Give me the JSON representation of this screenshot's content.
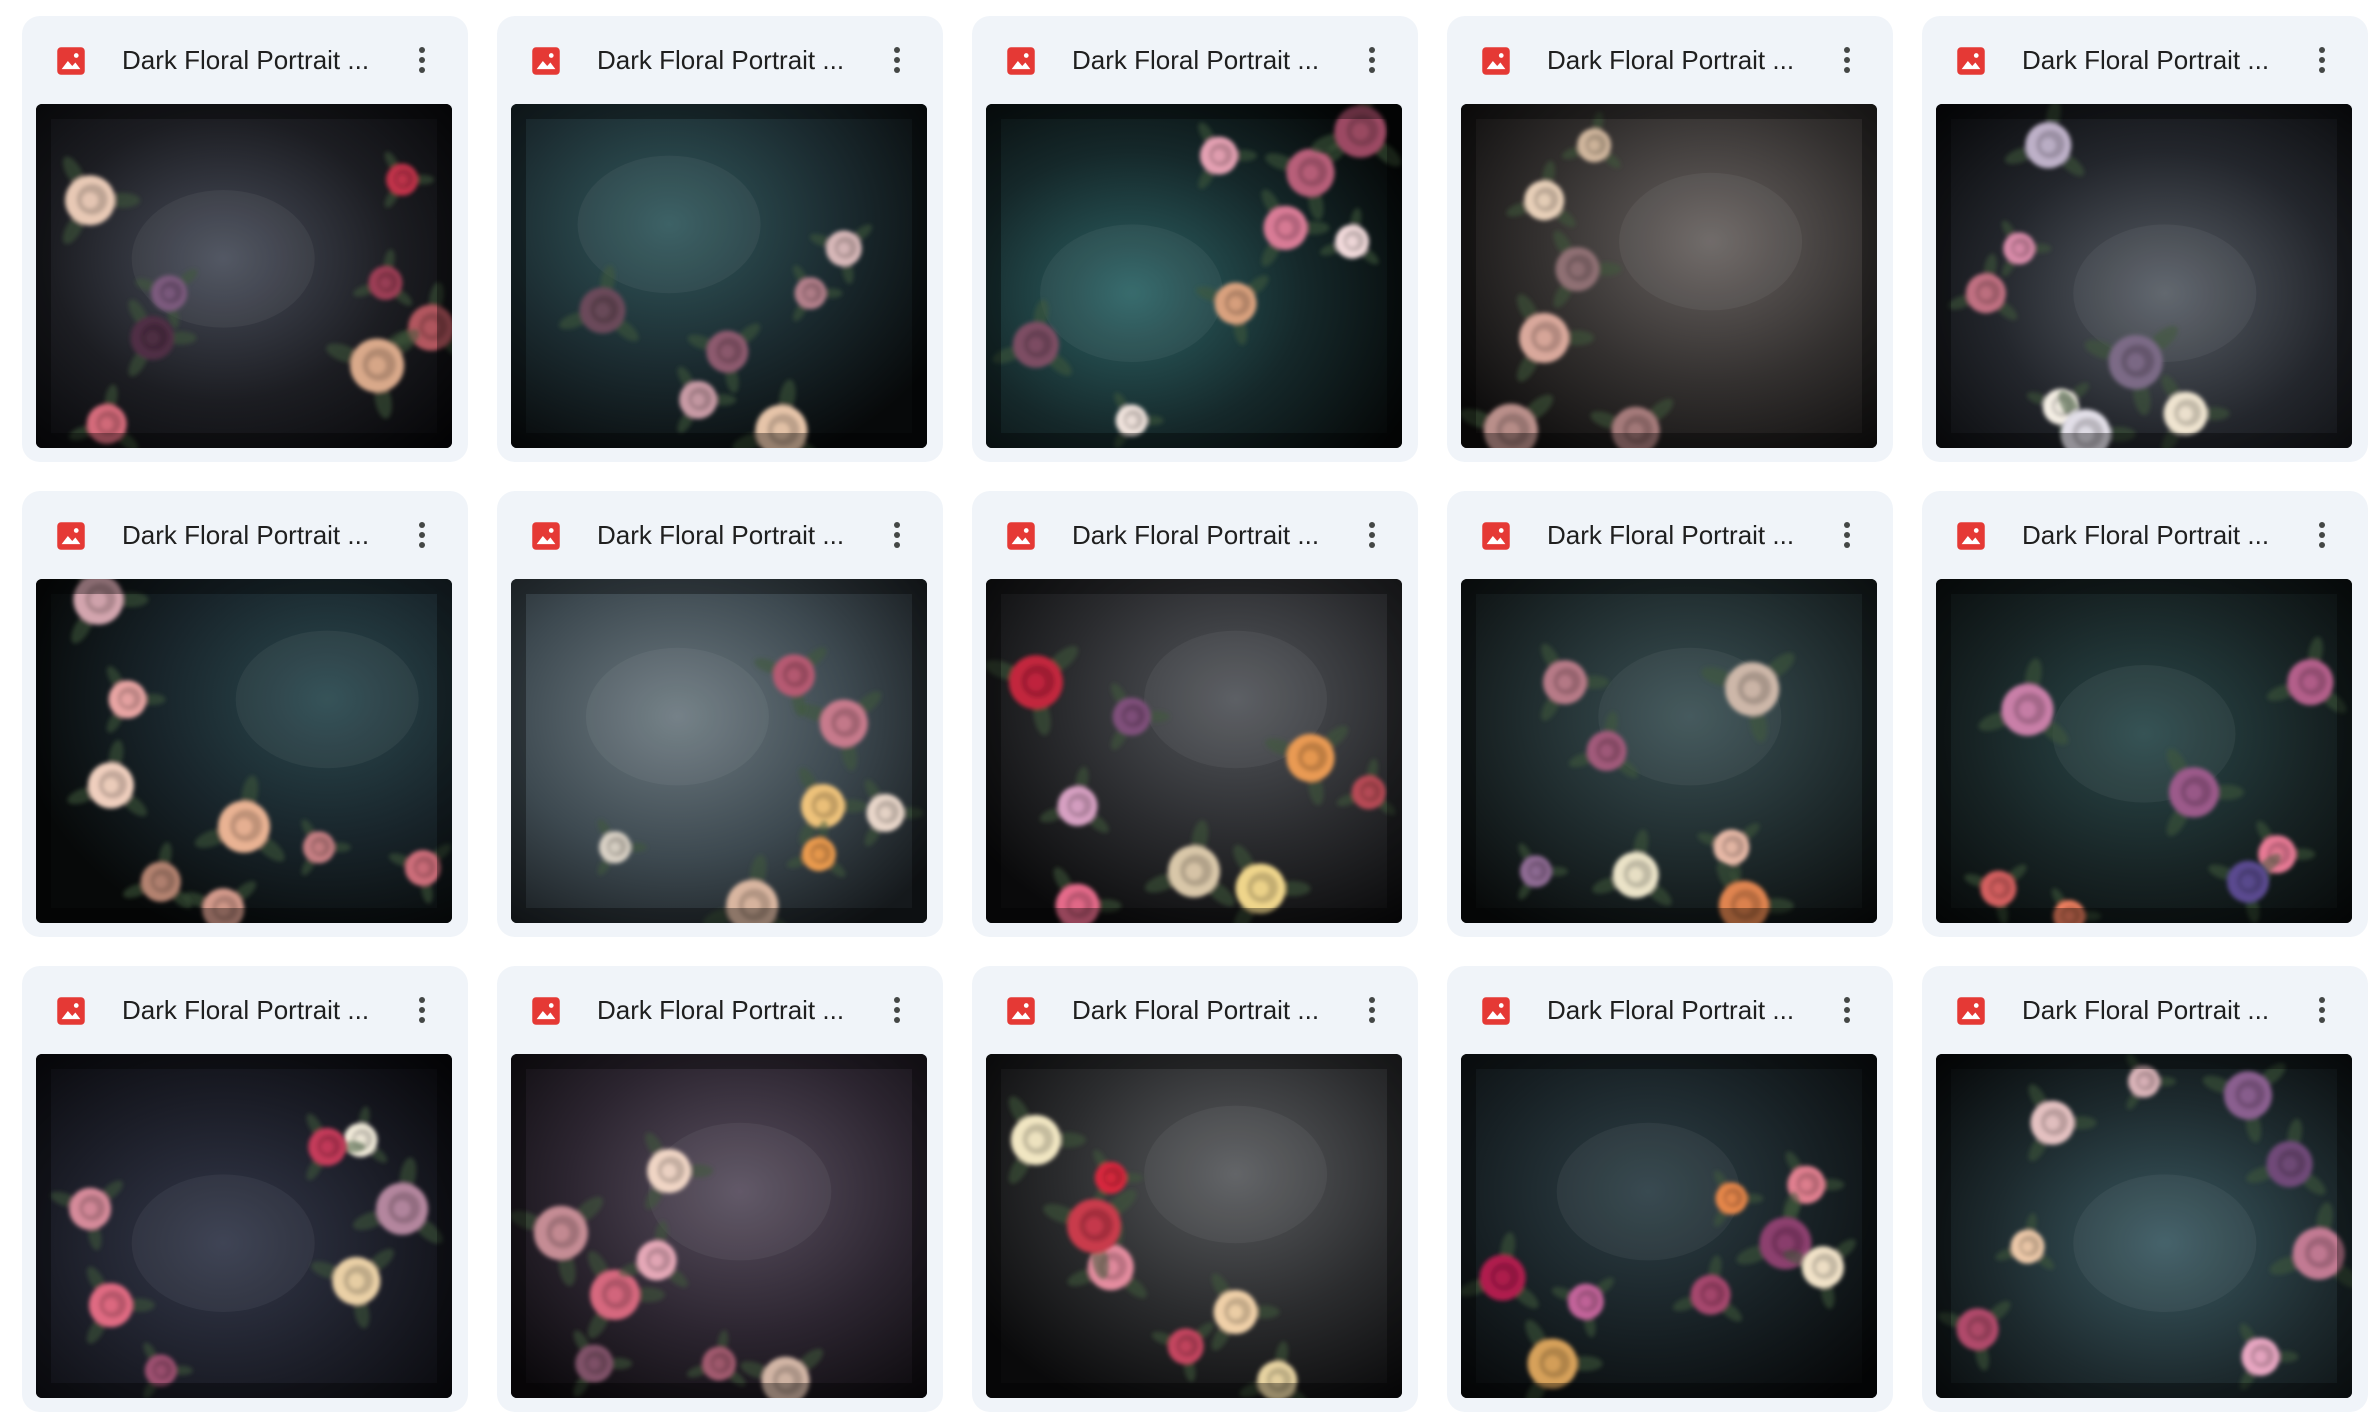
{
  "colors": {
    "card_bg": "#f0f4f9",
    "image_icon": "#e53935",
    "title_text": "#1f1f1f"
  },
  "icons": {
    "file_type": "image-file-icon",
    "menu": "more-vert-icon"
  },
  "files": [
    {
      "title": "Dark Floral Portrait ...",
      "thumbnail": {
        "bg": [
          "#4a4f5c",
          "#1c1d22",
          "#060608"
        ],
        "glow": [
          0.45,
          0.45
        ],
        "flowers": [
          [
            "#c0324a",
            0.88,
            0.22
          ],
          [
            "#b2565f",
            0.95,
            0.65
          ],
          [
            "#7b5a7d",
            0.32,
            0.55
          ],
          [
            "#e8c9b5",
            0.13,
            0.28
          ],
          [
            "#d46b7a",
            0.17,
            0.93
          ],
          [
            "#d9a98a",
            0.82,
            0.76
          ],
          [
            "#4f2f45",
            0.28,
            0.68
          ],
          [
            "#9b3e55",
            0.84,
            0.52
          ]
        ]
      }
    },
    {
      "title": "Dark Floral Portrait ...",
      "thumbnail": {
        "bg": [
          "#335a5e",
          "#1b2b30",
          "#07090a"
        ],
        "glow": [
          0.38,
          0.35
        ],
        "flowers": [
          [
            "#c79aa4",
            0.45,
            0.86
          ],
          [
            "#e6c4a9",
            0.65,
            0.95
          ],
          [
            "#8d5a6e",
            0.52,
            0.72
          ],
          [
            "#b27f8a",
            0.72,
            0.55
          ],
          [
            "#6a4a5a",
            0.22,
            0.6
          ],
          [
            "#d7b7b8",
            0.8,
            0.42
          ]
        ]
      }
    },
    {
      "title": "Dark Floral Portrait ...",
      "thumbnail": {
        "bg": [
          "#2e6466",
          "#15282a",
          "#050707"
        ],
        "glow": [
          0.35,
          0.55
        ],
        "flowers": [
          [
            "#d97b96",
            0.72,
            0.36
          ],
          [
            "#f1d9da",
            0.88,
            0.4
          ],
          [
            "#b85f79",
            0.78,
            0.2
          ],
          [
            "#e4a0b2",
            0.56,
            0.15
          ],
          [
            "#9c4a63",
            0.9,
            0.08
          ],
          [
            "#d9a17e",
            0.6,
            0.58
          ],
          [
            "#efe2dc",
            0.35,
            0.92
          ],
          [
            "#7d4e64",
            0.12,
            0.7
          ]
        ]
      }
    },
    {
      "title": "Dark Floral Portrait ...",
      "thumbnail": {
        "bg": [
          "#6a6462",
          "#33302f",
          "#0d0c0c"
        ],
        "glow": [
          0.6,
          0.4
        ],
        "flowers": [
          [
            "#d9a89b",
            0.2,
            0.68
          ],
          [
            "#e7cfb8",
            0.2,
            0.28
          ],
          [
            "#b98f8a",
            0.12,
            0.95
          ],
          [
            "#8f6f73",
            0.28,
            0.48
          ],
          [
            "#cfb59c",
            0.32,
            0.12
          ],
          [
            "#a57a7a",
            0.42,
            0.95
          ]
        ]
      }
    },
    {
      "title": "Dark Floral Portrait ...",
      "thumbnail": {
        "bg": [
          "#5a6068",
          "#23262c",
          "#08090b"
        ],
        "glow": [
          0.55,
          0.55
        ],
        "flowers": [
          [
            "#d78aa8",
            0.2,
            0.42
          ],
          [
            "#bdb0c8",
            0.27,
            0.12
          ],
          [
            "#f4eee4",
            0.3,
            0.88
          ],
          [
            "#e2dfe8",
            0.36,
            0.96
          ],
          [
            "#c07081",
            0.12,
            0.55
          ],
          [
            "#7c6a86",
            0.48,
            0.75
          ],
          [
            "#efe4d0",
            0.6,
            0.9
          ]
        ]
      }
    },
    {
      "title": "Dark Floral Portrait ...",
      "thumbnail": {
        "bg": [
          "#2c4a50",
          "#18242a",
          "#070909"
        ],
        "glow": [
          0.7,
          0.35
        ],
        "flowers": [
          [
            "#e8a4a3",
            0.22,
            0.35
          ],
          [
            "#e9b293",
            0.5,
            0.72
          ],
          [
            "#d39a8b",
            0.45,
            0.96
          ],
          [
            "#c47e82",
            0.68,
            0.78
          ],
          [
            "#f0cfbe",
            0.18,
            0.6
          ],
          [
            "#cc6d79",
            0.93,
            0.84
          ],
          [
            "#d3a5ae",
            0.15,
            0.06
          ],
          [
            "#b38270",
            0.3,
            0.88
          ]
        ]
      }
    },
    {
      "title": "Dark Floral Portrait ...",
      "thumbnail": {
        "bg": [
          "#6e7b82",
          "#3d4950",
          "#15191c"
        ],
        "glow": [
          0.4,
          0.4
        ],
        "flowers": [
          [
            "#eec27a",
            0.75,
            0.66
          ],
          [
            "#e99a4e",
            0.74,
            0.8
          ],
          [
            "#c77a8c",
            0.8,
            0.42
          ],
          [
            "#e8d6c9",
            0.9,
            0.68
          ],
          [
            "#d9b6a0",
            0.58,
            0.95
          ],
          [
            "#b65a72",
            0.68,
            0.28
          ],
          [
            "#d8d0c4",
            0.25,
            0.78
          ]
        ]
      }
    },
    {
      "title": "Dark Floral Portrait ...",
      "thumbnail": {
        "bg": [
          "#55585d",
          "#2a2b2e",
          "#0a0a0b"
        ],
        "glow": [
          0.6,
          0.35
        ],
        "flowers": [
          [
            "#efd58b",
            0.66,
            0.9
          ],
          [
            "#d7a0c2",
            0.22,
            0.66
          ],
          [
            "#c2253d",
            0.12,
            0.3
          ],
          [
            "#e56a8a",
            0.22,
            0.95
          ],
          [
            "#b64a55",
            0.92,
            0.62
          ],
          [
            "#e99a52",
            0.78,
            0.52
          ],
          [
            "#7f4f7a",
            0.35,
            0.4
          ],
          [
            "#d9c7a9",
            0.5,
            0.85
          ]
        ]
      }
    },
    {
      "title": "Dark Floral Portrait ...",
      "thumbnail": {
        "bg": [
          "#3c5256",
          "#1e2a2c",
          "#080a0a"
        ],
        "glow": [
          0.55,
          0.4
        ],
        "flowers": [
          [
            "#8e6b93",
            0.18,
            0.85
          ],
          [
            "#ebe3c8",
            0.42,
            0.86
          ],
          [
            "#e6b8a6",
            0.65,
            0.78
          ],
          [
            "#e0844f",
            0.68,
            0.95
          ],
          [
            "#a15a7a",
            0.35,
            0.5
          ],
          [
            "#cdb7a9",
            0.7,
            0.32
          ],
          [
            "#b77a87",
            0.25,
            0.3
          ]
        ]
      }
    },
    {
      "title": "Dark Floral Portrait ...",
      "thumbnail": {
        "bg": [
          "#2c4a4c",
          "#172324",
          "#060808"
        ],
        "glow": [
          0.5,
          0.45
        ],
        "flowers": [
          [
            "#e87a95",
            0.82,
            0.8
          ],
          [
            "#c97fa8",
            0.22,
            0.38
          ],
          [
            "#5a4a8f",
            0.75,
            0.88
          ],
          [
            "#f08060",
            0.32,
            0.98
          ],
          [
            "#b35e8a",
            0.9,
            0.3
          ],
          [
            "#d35f5f",
            0.15,
            0.9
          ],
          [
            "#9b5a8a",
            0.62,
            0.62
          ]
        ]
      }
    },
    {
      "title": "Dark Floral Portrait ...",
      "thumbnail": {
        "bg": [
          "#353a4c",
          "#1b1d27",
          "#07070a"
        ],
        "glow": [
          0.45,
          0.55
        ],
        "flowers": [
          [
            "#e06a82",
            0.18,
            0.73
          ],
          [
            "#f1ead9",
            0.78,
            0.25
          ],
          [
            "#ead0a6",
            0.77,
            0.66
          ],
          [
            "#c43a5a",
            0.7,
            0.27
          ],
          [
            "#b4869e",
            0.88,
            0.45
          ],
          [
            "#d58a9a",
            0.13,
            0.45
          ],
          [
            "#9c4f6f",
            0.3,
            0.92
          ]
        ]
      }
    },
    {
      "title": "Dark Floral Portrait ...",
      "thumbnail": {
        "bg": [
          "#5a5060",
          "#2c2530",
          "#0b090c"
        ],
        "glow": [
          0.55,
          0.4
        ],
        "flowers": [
          [
            "#d6677e",
            0.25,
            0.7
          ],
          [
            "#e5a8b7",
            0.35,
            0.6
          ],
          [
            "#c58c94",
            0.12,
            0.52
          ],
          [
            "#f0d5c5",
            0.38,
            0.34
          ],
          [
            "#a15a6e",
            0.5,
            0.9
          ],
          [
            "#d2b5a5",
            0.66,
            0.95
          ],
          [
            "#7f5168",
            0.2,
            0.9
          ]
        ]
      }
    },
    {
      "title": "Dark Floral Portrait ...",
      "thumbnail": {
        "bg": [
          "#5b5d60",
          "#2b2c2e",
          "#0a0a0b"
        ],
        "glow": [
          0.6,
          0.35
        ],
        "flowers": [
          [
            "#d8283c",
            0.3,
            0.36
          ],
          [
            "#e48c9f",
            0.3,
            0.62
          ],
          [
            "#c3455e",
            0.48,
            0.85
          ],
          [
            "#f1e6c2",
            0.12,
            0.25
          ],
          [
            "#e7d3a1",
            0.7,
            0.95
          ],
          [
            "#c93a4c",
            0.26,
            0.5
          ],
          [
            "#f0d0a8",
            0.6,
            0.75
          ]
        ]
      }
    },
    {
      "title": "Dark Floral Portrait ...",
      "thumbnail": {
        "bg": [
          "#2f4148",
          "#172024",
          "#060708"
        ],
        "glow": [
          0.45,
          0.4
        ],
        "flowers": [
          [
            "#e07f8f",
            0.83,
            0.38
          ],
          [
            "#8c3f6e",
            0.78,
            0.55
          ],
          [
            "#f1e2c8",
            0.87,
            0.62
          ],
          [
            "#e5864a",
            0.65,
            0.42
          ],
          [
            "#b01e4d",
            0.1,
            0.65
          ],
          [
            "#c2649a",
            0.3,
            0.72
          ],
          [
            "#d7a15a",
            0.22,
            0.9
          ],
          [
            "#a5466d",
            0.6,
            0.7
          ]
        ]
      }
    },
    {
      "title": "Dark Floral Portrait ...",
      "thumbnail": {
        "bg": [
          "#3c5b63",
          "#1d2a2e",
          "#07090a"
        ],
        "glow": [
          0.55,
          0.55
        ],
        "flowers": [
          [
            "#e4c1c1",
            0.28,
            0.2
          ],
          [
            "#ecc8a8",
            0.22,
            0.56
          ],
          [
            "#8a5f8f",
            0.75,
            0.12
          ],
          [
            "#e7a6c1",
            0.78,
            0.88
          ],
          [
            "#c27a93",
            0.92,
            0.58
          ],
          [
            "#b04a6a",
            0.1,
            0.8
          ],
          [
            "#d9b3b8",
            0.5,
            0.08
          ],
          [
            "#6f4a78",
            0.85,
            0.32
          ]
        ]
      }
    }
  ]
}
